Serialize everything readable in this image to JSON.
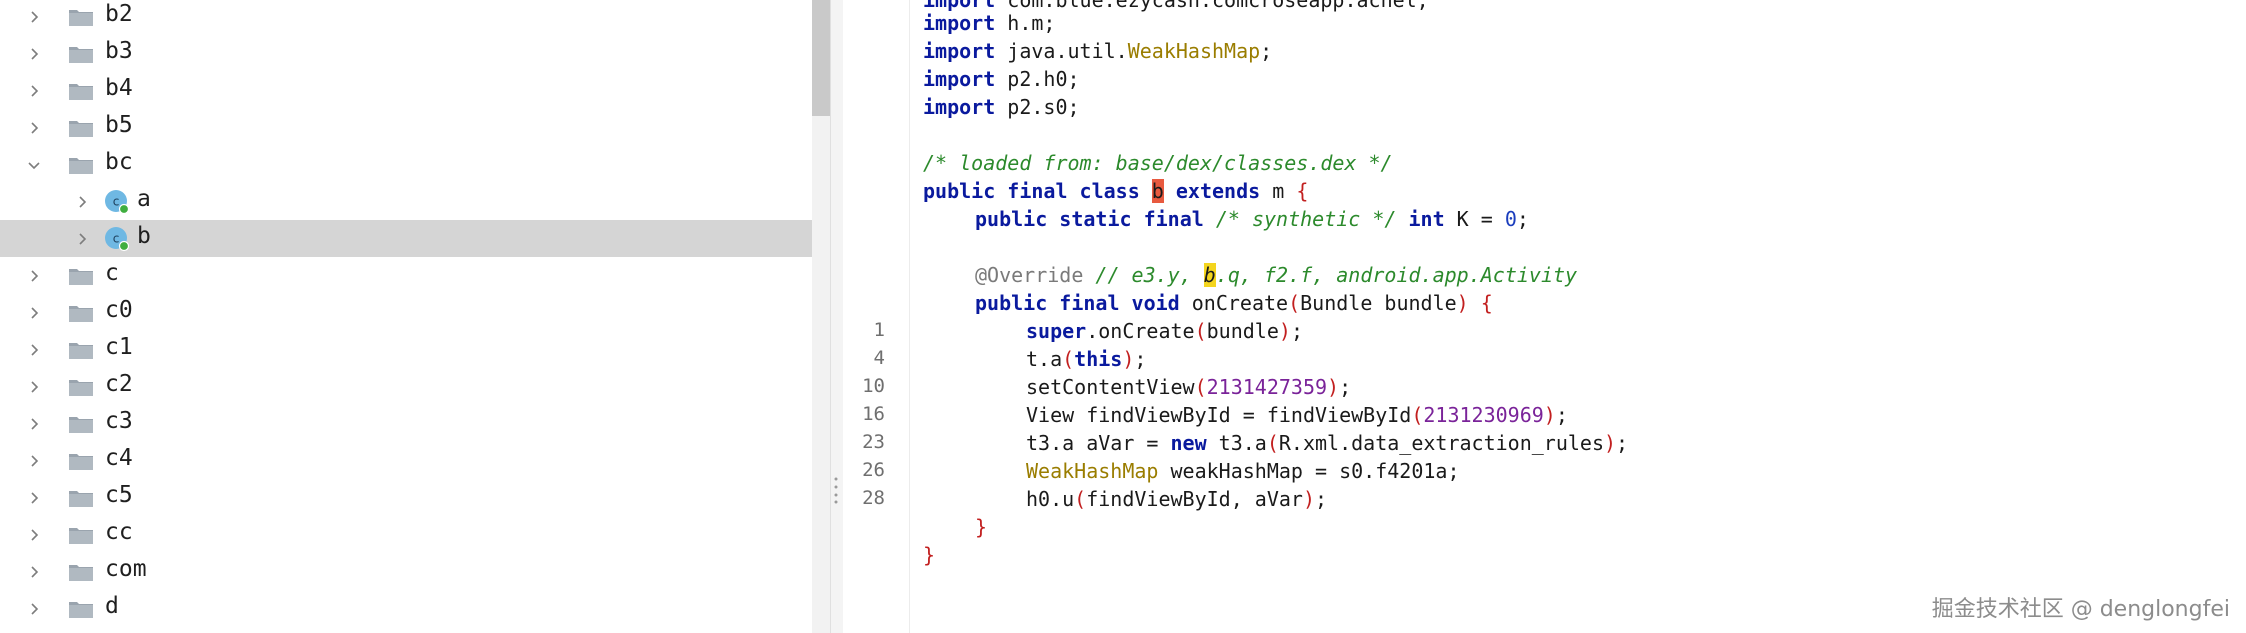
{
  "tree": {
    "items": [
      {
        "label": "b2",
        "kind": "folder",
        "expanded": false
      },
      {
        "label": "b3",
        "kind": "folder",
        "expanded": false
      },
      {
        "label": "b4",
        "kind": "folder",
        "expanded": false
      },
      {
        "label": "b5",
        "kind": "folder",
        "expanded": false
      },
      {
        "label": "bc",
        "kind": "folder",
        "expanded": true
      },
      {
        "label": "a",
        "kind": "class",
        "expanded": false
      },
      {
        "label": "b",
        "kind": "class",
        "expanded": false,
        "selected": true
      },
      {
        "label": "c",
        "kind": "folder",
        "expanded": false
      },
      {
        "label": "c0",
        "kind": "folder",
        "expanded": false
      },
      {
        "label": "c1",
        "kind": "folder",
        "expanded": false
      },
      {
        "label": "c2",
        "kind": "folder",
        "expanded": false
      },
      {
        "label": "c3",
        "kind": "folder",
        "expanded": false
      },
      {
        "label": "c4",
        "kind": "folder",
        "expanded": false
      },
      {
        "label": "c5",
        "kind": "folder",
        "expanded": false
      },
      {
        "label": "cc",
        "kind": "folder",
        "expanded": false
      },
      {
        "label": "com",
        "kind": "folder",
        "expanded": false
      },
      {
        "label": "d",
        "kind": "folder",
        "expanded": false
      }
    ]
  },
  "editor": {
    "line_numbers": [
      "1",
      "4",
      "10",
      "16",
      "23",
      "26",
      "28"
    ],
    "code": {
      "l0_kw": "import",
      "l0_rest": " com.blue.ezycash.comcroseapp.achel;",
      "l1_kw": "import",
      "l1_rest": " h.m;",
      "l2_kw": "import",
      "l2_a": " java.util.",
      "l2_type": "WeakHashMap",
      "l2_b": ";",
      "l3_kw": "import",
      "l3_rest": " p2.h0;",
      "l4_kw": "import",
      "l4_rest": " p2.s0;",
      "l6_comment": "/* loaded from: base/dex/classes.dex */",
      "l7_kw": "public final class",
      "l7_hl": "b",
      "l7_kw2": "extends",
      "l7_rest": " m ",
      "l7_brace": "{",
      "l8_kw": "public static final",
      "l8_comment": "/* synthetic */",
      "l8_kw2": "int",
      "l8_a": " K = ",
      "l8_num": "0",
      "l8_b": ";",
      "l10_ann": "@Override",
      "l10_c1": " // e3.y, ",
      "l10_hl": "b",
      "l10_c2": ".q, f2.f, android.app.Activity",
      "l11_kw": "public final void",
      "l11_a": " onCreate",
      "l11_p1": "(",
      "l11_b": "Bundle bundle",
      "l11_p2": ")",
      "l11_c": " ",
      "l11_brace": "{",
      "l12_kw": "super",
      "l12_a": ".onCreate",
      "l12_p1": "(",
      "l12_b": "bundle",
      "l12_p2": ")",
      "l12_c": ";",
      "l13_a": "t.a",
      "l13_p1": "(",
      "l13_kw": "this",
      "l13_p2": ")",
      "l13_b": ";",
      "l14_a": "setContentView",
      "l14_p1": "(",
      "l14_num": "2131427359",
      "l14_p2": ")",
      "l14_b": ";",
      "l15_a": "View findViewById = findViewById",
      "l15_p1": "(",
      "l15_num": "2131230969",
      "l15_p2": ")",
      "l15_b": ";",
      "l16_a": "t3.a aVar = ",
      "l16_kw": "new",
      "l16_b": " t3.a",
      "l16_p1": "(",
      "l16_c": "R.xml.data_extraction_rules",
      "l16_p2": ")",
      "l16_d": ";",
      "l17_type": "WeakHashMap",
      "l17_a": " weakHashMap = s0.f4201a;",
      "l18_a": "h0.u",
      "l18_p1": "(",
      "l18_b": "findViewById, aVar",
      "l18_p2": ")",
      "l18_c": ";",
      "l19_brace": "}",
      "l20_brace": "}"
    }
  },
  "watermark": "掘金技术社区 @ denglongfei",
  "colors": {
    "keyword": "#0a1a9e",
    "type": "#9a7d00",
    "comment": "#2c8a2c",
    "number": "#1a3dbd",
    "paren": "#c21f1f",
    "selection": "#d5d5d5",
    "highlight_red": "#e85a3f",
    "highlight_yellow": "#f4d51e"
  }
}
